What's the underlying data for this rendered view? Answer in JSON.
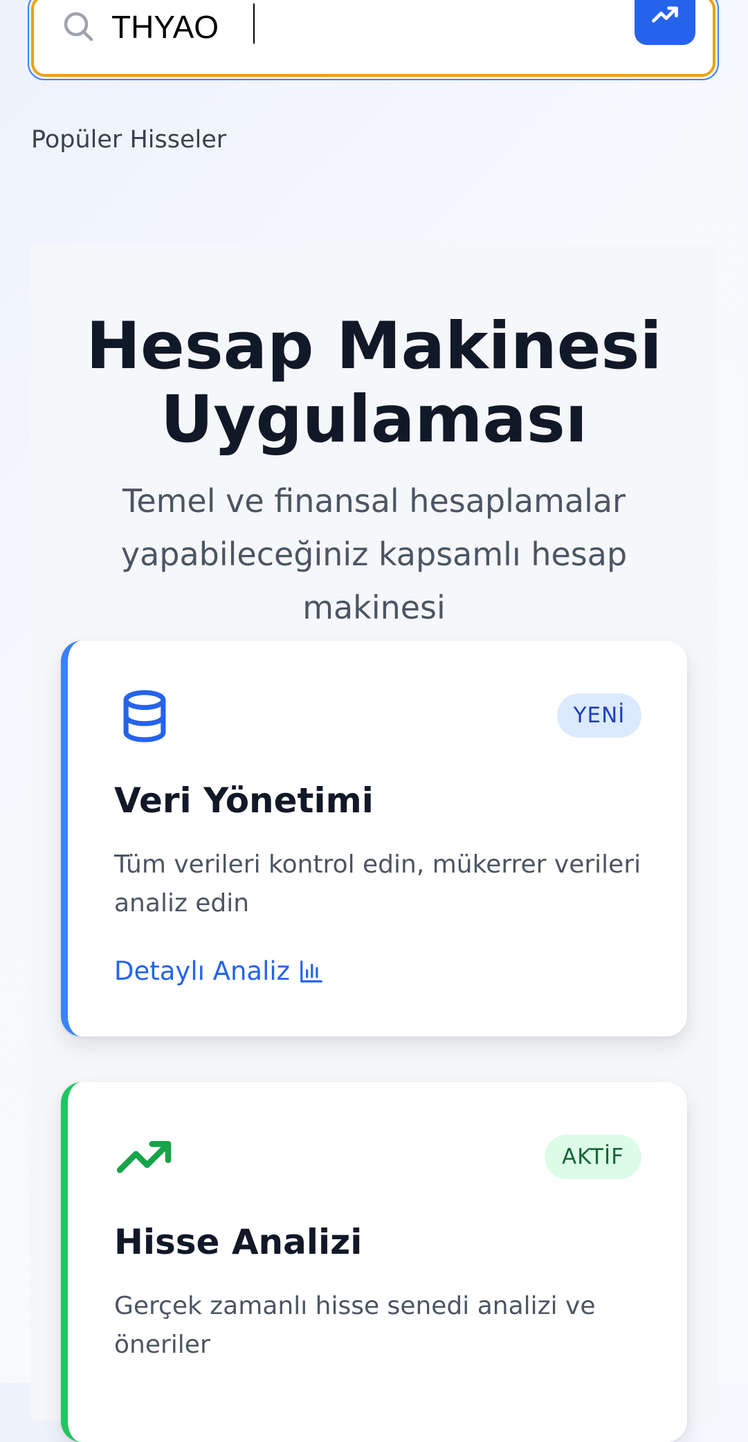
{
  "search": {
    "value": "THYAO",
    "icon": "search-icon",
    "trend_button_icon": "trending-up-icon"
  },
  "popular": {
    "label": "Popüler Hisseler"
  },
  "app": {
    "title": "Hesap Makinesi Uygulaması",
    "subtitle": "Temel ve finansal hesaplamalar yapabileceğiniz kapsamlı hesap makinesi"
  },
  "cards": [
    {
      "icon": "database-icon",
      "badge": "YENİ",
      "title": "Veri Yönetimi",
      "description": "Tüm verileri kontrol edin, mükerrer verileri analiz edin",
      "link": "Detaylı Analiz",
      "link_icon": "bar-chart-icon",
      "accent": "#3b82f6"
    },
    {
      "icon": "trending-up-icon",
      "badge": "AKTİF",
      "title": "Hisse Analizi",
      "description": "Gerçek zamanlı hisse senedi analizi ve öneriler",
      "accent": "#22c55e"
    }
  ],
  "colors": {
    "primary": "#2563eb",
    "search_focus_border": "#eba10f",
    "green_accent": "#16a34a"
  }
}
